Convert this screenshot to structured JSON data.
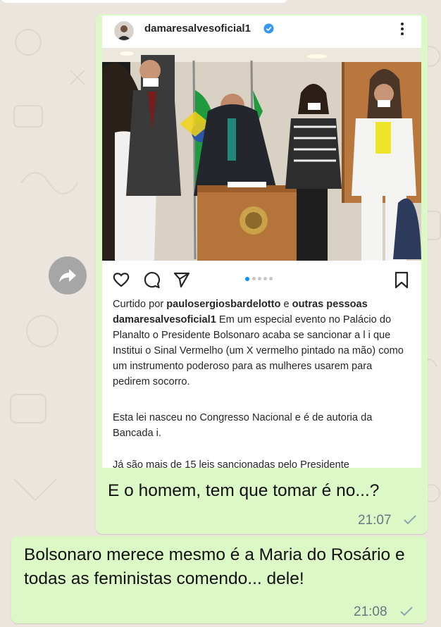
{
  "instagram_post": {
    "username": "damaresalvesoficial1",
    "liked_by_prefix": "Curtido por ",
    "liked_by_user": "paulosergiosbardelotto",
    "liked_by_mid": " e ",
    "liked_by_others": "outras pessoas",
    "caption_user": "damaresalvesoficial1",
    "caption_text": " Em um especial evento no Palácio do Planalto o Presidente Bolsonaro acaba se sancionar a l i que Institui o Sinal Vermelho (um X vermelho pintado na mão)  como um instrumento poderoso para as mulheres usarem para  pedirem socorro.",
    "paragraph_2": "Esta lei nasceu no Congresso Nacional e é de autoria da Bancada i.",
    "paragraph_3": "Já são mais de 15 leis sancionadas pelo Presidente",
    "icons": [
      "heart-icon",
      "comment-icon",
      "share-icon",
      "bookmark-icon",
      "more-icon",
      "verified-icon"
    ]
  },
  "messages": [
    {
      "text": "E o homem, tem que tomar é no...?",
      "time": "21:07"
    },
    {
      "text": "Bolsonaro merece mesmo é a Maria do Rosário e todas as feministas comendo... dele!",
      "time": "21:08"
    }
  ],
  "colors": {
    "outgoing_bubble": "#dcf8c6",
    "chat_background": "#ece5dd",
    "timestamp": "#667781",
    "carousel_active": "#0095f6"
  }
}
